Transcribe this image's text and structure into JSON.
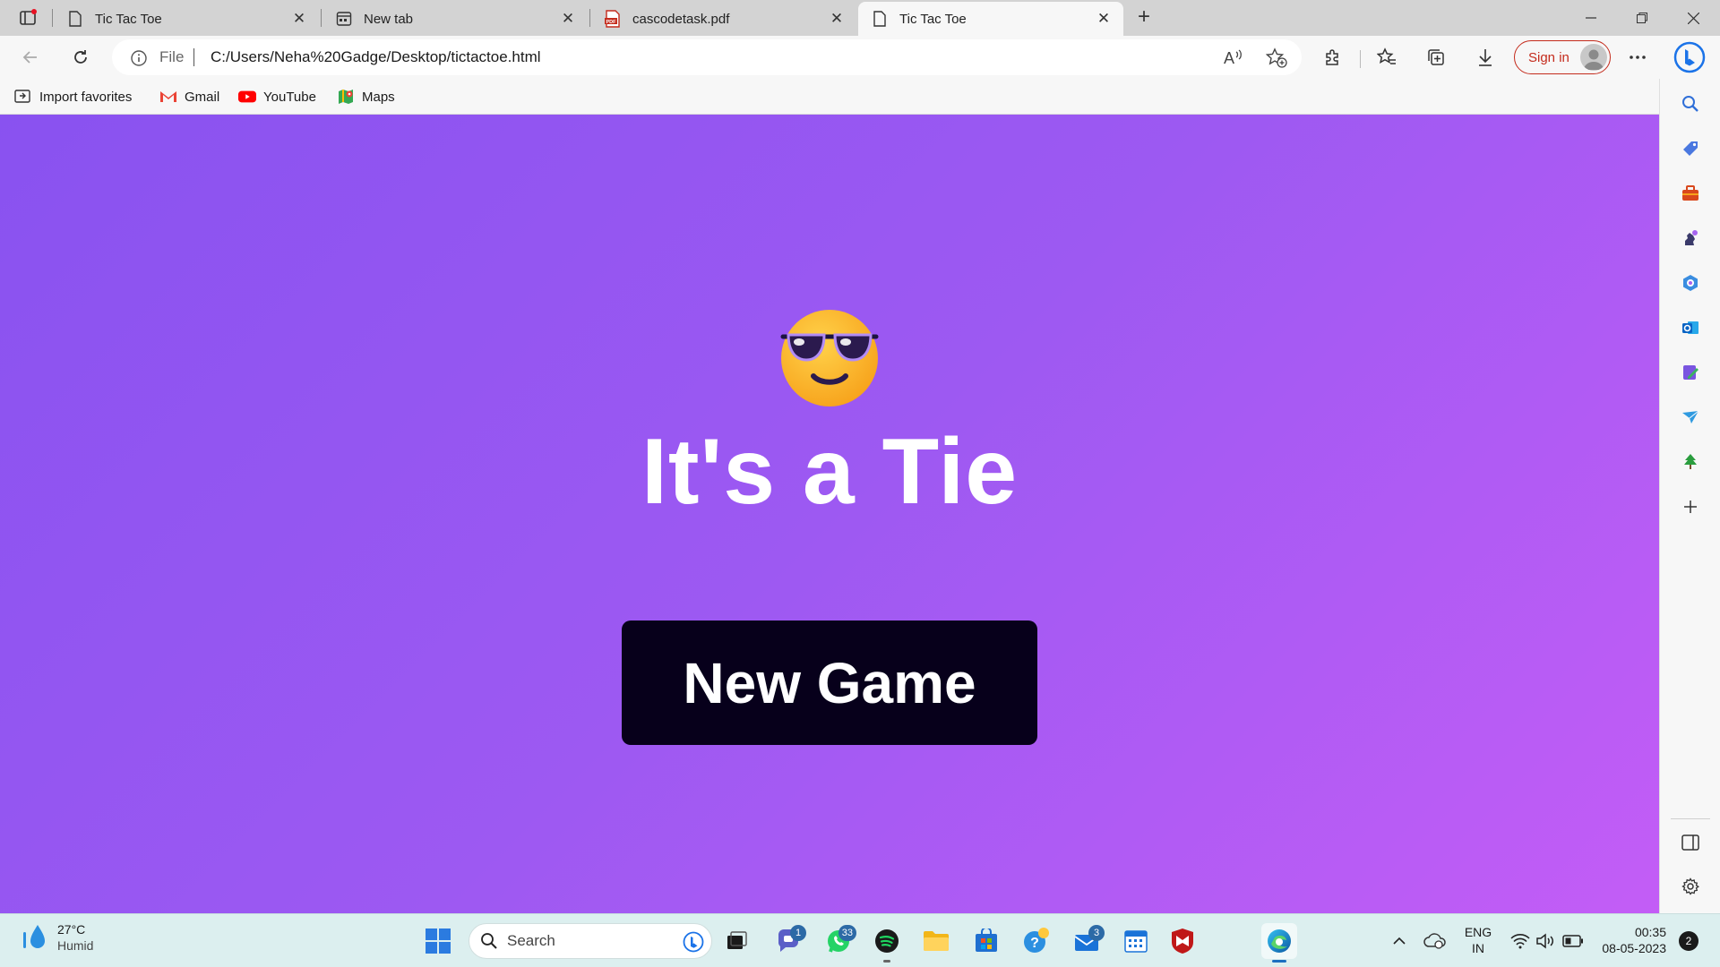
{
  "browser": {
    "tabs": [
      {
        "title": "Tic Tac Toe",
        "icon": "page-icon",
        "active": false
      },
      {
        "title": "New tab",
        "icon": "newtab-icon",
        "active": false
      },
      {
        "title": "cascodetask.pdf",
        "icon": "pdf-icon",
        "active": false
      },
      {
        "title": "Tic Tac Toe",
        "icon": "page-icon",
        "active": true
      }
    ],
    "address": {
      "scheme_label": "File",
      "url": "C:/Users/Neha%20Gadge/Desktop/tictactoe.html"
    },
    "signin_label": "Sign in",
    "favorites": [
      {
        "label": "Import favorites",
        "icon": "import-icon"
      },
      {
        "label": "Gmail",
        "icon": "gmail-icon"
      },
      {
        "label": "YouTube",
        "icon": "youtube-icon"
      },
      {
        "label": "Maps",
        "icon": "maps-icon"
      }
    ]
  },
  "game": {
    "emoji": "smiling-face-with-sunglasses",
    "result_text": "It's a Tie",
    "new_game_label": "New Game",
    "background_start": "#8952f0",
    "background_end": "#c35df6",
    "button_color": "#07001b"
  },
  "taskbar": {
    "weather": {
      "temp": "27°C",
      "condition": "Humid"
    },
    "search_placeholder": "Search",
    "badges": {
      "teams": "1",
      "whatsapp": "33",
      "mail": "3"
    },
    "language": {
      "line1": "ENG",
      "line2": "IN"
    },
    "clock": {
      "time": "00:35",
      "date": "08-05-2023"
    },
    "notification_count": "2"
  }
}
